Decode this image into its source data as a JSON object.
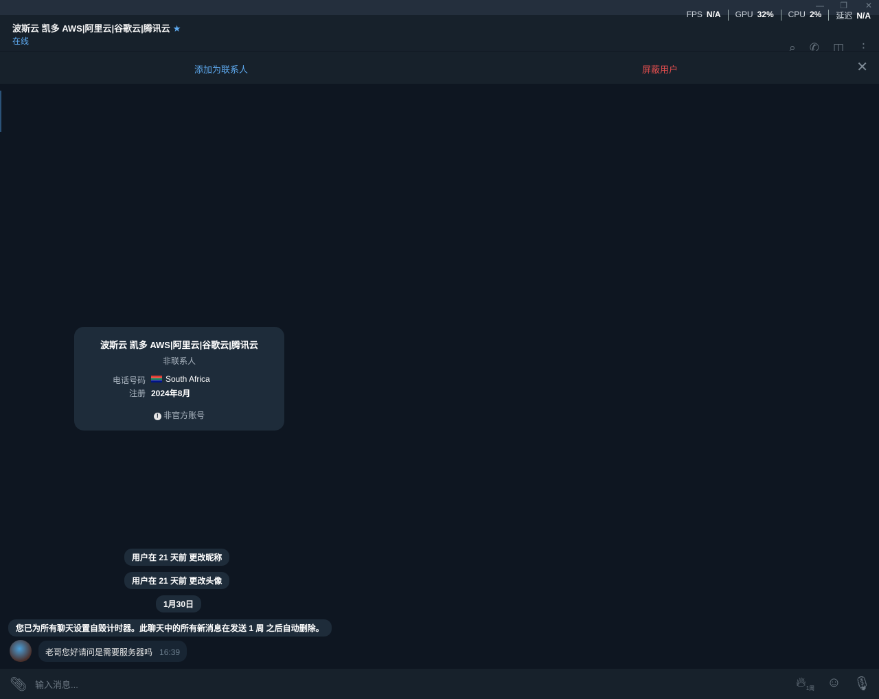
{
  "header": {
    "name": "波斯云 凯多 AWS|阿里云|谷歌云|腾讯云",
    "status": "在线"
  },
  "stats": {
    "fps_label": "FPS",
    "fps": "N/A",
    "gpu_label": "GPU",
    "gpu": "32%",
    "cpu_label": "CPU",
    "cpu": "2%",
    "latency_label": "延迟",
    "latency": "N/A"
  },
  "actions": {
    "add": "添加为联系人",
    "block": "屏蔽用户"
  },
  "card": {
    "title": "波斯云 凯多 AWS|阿里云|谷歌云|腾讯云",
    "subtitle": "非联系人",
    "phone_label": "电话号码",
    "phone_value": "South Africa",
    "reg_label": "注册",
    "reg_value": "2024年8月",
    "notice": "非官方账号"
  },
  "service": [
    "用户在 21 天前 更改昵称",
    "用户在 21 天前 更改头像",
    "1月30日",
    "您已为所有聊天设置自毁计时器。此聊天中的所有新消息在发送 1 周 之后自动删除。"
  ],
  "message": {
    "text": "老哥您好请问是需要服务器吗",
    "time": "16:39"
  },
  "composer": {
    "placeholder": "输入消息...",
    "timer": "1周"
  }
}
